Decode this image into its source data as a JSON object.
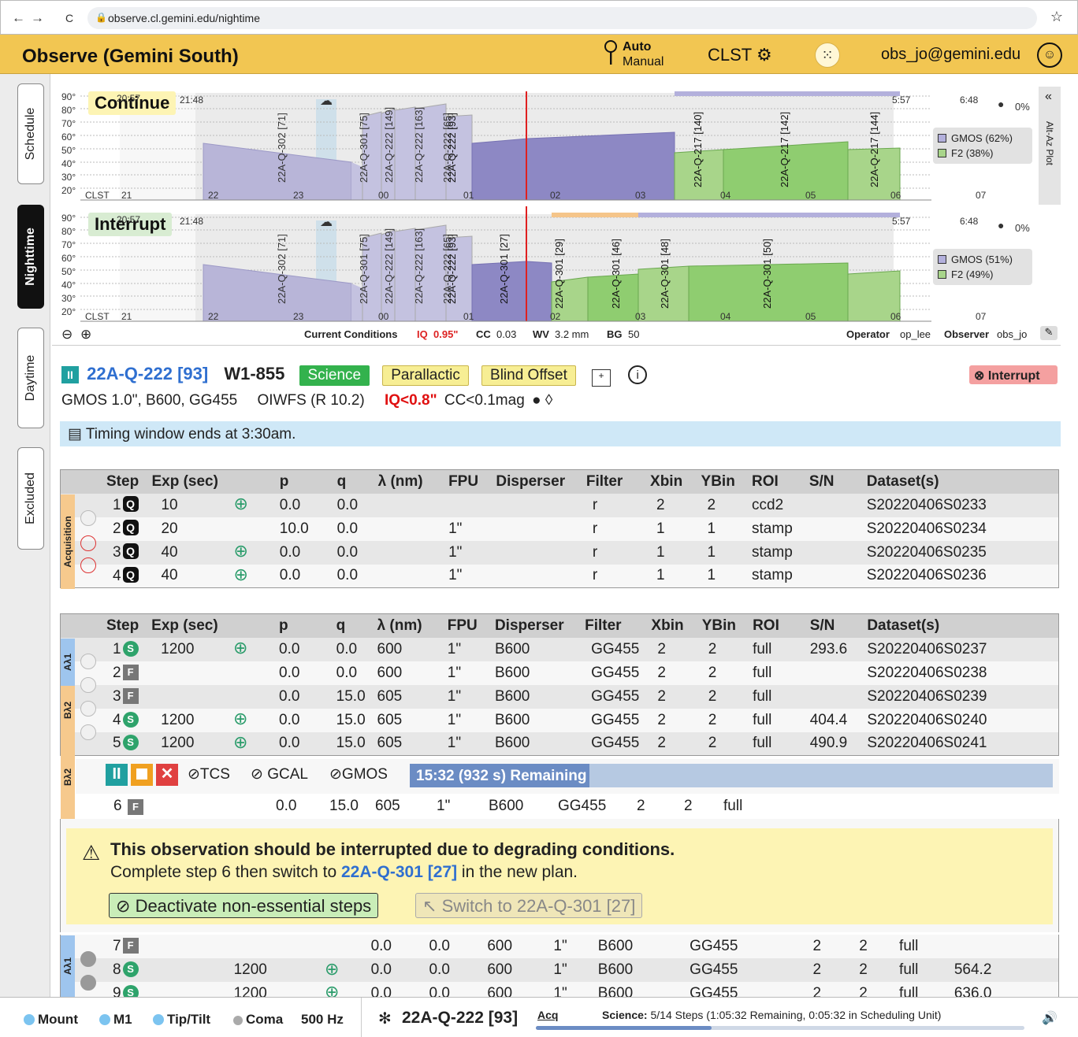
{
  "browser": {
    "back": "←",
    "forward": "→",
    "reload": "C",
    "url": "observe.cl.gemini.edu/nightime",
    "star": "☆"
  },
  "app": {
    "title": "Observe (Gemini South)",
    "mode_auto": "Auto",
    "mode_manual": "Manual",
    "clst": "CLST",
    "user": "obs_jo@gemini.edu"
  },
  "sidebar": {
    "tabs": [
      "Schedule",
      "Nighttime",
      "Daytime",
      "Excluded"
    ],
    "active": "Nighttime"
  },
  "plots": {
    "y_ticks": [
      "90°",
      "80°",
      "70°",
      "60°",
      "50°",
      "40°",
      "30°",
      "20°"
    ],
    "hours": [
      "CLST",
      "21",
      "22",
      "23",
      "00",
      "01",
      "02",
      "03",
      "04",
      "05",
      "06",
      "07"
    ],
    "twilight_labels": [
      "20:57",
      "21:48",
      "5:57",
      "6:48"
    ],
    "moon": "0%",
    "altaz": "Alt-Az Plot",
    "continue": {
      "label": "Continue",
      "legend": [
        {
          "name": "GMOS (62%)",
          "color": "#b3b0dc"
        },
        {
          "name": "F2 (38%)",
          "color": "#a8d58a"
        }
      ],
      "obs": [
        "22A-Q-302 [71]",
        "22A-Q-301 [75]",
        "22A-Q-222 [149]",
        "22A-Q-222 [163]",
        "22A-Q-222 [65]",
        "22A-Q-222 [93]",
        "22A-Q-217 [140]",
        "22A-Q-217 [142]",
        "22A-Q-217 [144]"
      ]
    },
    "interrupt": {
      "label": "Interrupt",
      "legend": [
        {
          "name": "GMOS (51%)",
          "color": "#b3b0dc"
        },
        {
          "name": "F2 (49%)",
          "color": "#a8d58a"
        }
      ],
      "obs": [
        "22A-Q-302 [71]",
        "22A-Q-301 [75]",
        "22A-Q-222 [149]",
        "22A-Q-222 [163]",
        "22A-Q-222 [65]",
        "22A-Q-222 [93]",
        "22A-Q-301 [27]",
        "22A-Q-301 [29]",
        "22A-Q-301 [46]",
        "22A-Q-301 [48]",
        "22A-Q-301 [50]"
      ]
    }
  },
  "conditions": {
    "label": "Current Conditions",
    "iq_label": "IQ",
    "iq": "0.95\"",
    "cc_label": "CC",
    "cc": "0.03",
    "wv_label": "WV",
    "wv": "3.2 mm",
    "bg_label": "BG",
    "bg": "50",
    "operator_label": "Operator",
    "operator": "op_lee",
    "observer_label": "Observer",
    "observer": "obs_jo"
  },
  "observation": {
    "id": "22A-Q-222 [93]",
    "target": "W1-855",
    "badges": [
      "Science",
      "Parallactic",
      "Blind Offset"
    ],
    "instrument": "GMOS 1.0\", B600, GG455",
    "oiwfs": "OIWFS (R 10.2)",
    "iq_req": "IQ<0.8\"",
    "cc_req": "CC<0.1mag",
    "interrupt": "Interrupt",
    "timing": "Timing window ends at 3:30am."
  },
  "columns": [
    "Step",
    "Exp (sec)",
    "",
    "p",
    "q",
    "λ (nm)",
    "FPU",
    "Disperser",
    "Filter",
    "Xbin",
    "YBin",
    "ROI",
    "S/N",
    "Dataset(s)"
  ],
  "acq_label": "Acquisition",
  "acquisition": [
    {
      "step": "1",
      "type": "Q",
      "exp": "10",
      "target": true,
      "p": "0.0",
      "q": "0.0",
      "lambda": "",
      "fpu": "",
      "disp": "",
      "filter": "r",
      "xbin": "2",
      "ybin": "2",
      "roi": "ccd2",
      "sn": "",
      "ds": "S20220406S0233"
    },
    {
      "step": "2",
      "type": "Q",
      "exp": "20",
      "target": false,
      "p": "10.0",
      "q": "0.0",
      "lambda": "",
      "fpu": "1\"",
      "disp": "",
      "filter": "r",
      "xbin": "1",
      "ybin": "1",
      "roi": "stamp",
      "sn": "",
      "ds": "S20220406S0234"
    },
    {
      "step": "3",
      "type": "Q",
      "exp": "40",
      "target": true,
      "p": "0.0",
      "q": "0.0",
      "lambda": "",
      "fpu": "1\"",
      "disp": "",
      "filter": "r",
      "xbin": "1",
      "ybin": "1",
      "roi": "stamp",
      "sn": "",
      "ds": "S20220406S0235"
    },
    {
      "step": "4",
      "type": "Q",
      "exp": "40",
      "target": true,
      "p": "0.0",
      "q": "0.0",
      "lambda": "",
      "fpu": "1\"",
      "disp": "",
      "filter": "r",
      "xbin": "1",
      "ybin": "1",
      "roi": "stamp",
      "sn": "",
      "ds": "S20220406S0236"
    }
  ],
  "groups": [
    "Aλ1",
    "Bλ2",
    "Bλ2",
    "Aλ1"
  ],
  "science": [
    {
      "step": "1",
      "type": "S",
      "exp": "1200",
      "target": true,
      "p": "0.0",
      "q": "0.0",
      "lambda": "600",
      "fpu": "1\"",
      "disp": "B600",
      "filter": "GG455",
      "xbin": "2",
      "ybin": "2",
      "roi": "full",
      "sn": "293.6",
      "ds": "S20220406S0237"
    },
    {
      "step": "2",
      "type": "F",
      "exp": "",
      "target": false,
      "p": "0.0",
      "q": "0.0",
      "lambda": "600",
      "fpu": "1\"",
      "disp": "B600",
      "filter": "GG455",
      "xbin": "2",
      "ybin": "2",
      "roi": "full",
      "sn": "",
      "ds": "S20220406S0238"
    },
    {
      "step": "3",
      "type": "F",
      "exp": "",
      "target": false,
      "p": "0.0",
      "q": "15.0",
      "lambda": "605",
      "fpu": "1\"",
      "disp": "B600",
      "filter": "GG455",
      "xbin": "2",
      "ybin": "2",
      "roi": "full",
      "sn": "",
      "ds": "S20220406S0239"
    },
    {
      "step": "4",
      "type": "S",
      "exp": "1200",
      "target": true,
      "p": "0.0",
      "q": "15.0",
      "lambda": "605",
      "fpu": "1\"",
      "disp": "B600",
      "filter": "GG455",
      "xbin": "2",
      "ybin": "2",
      "roi": "full",
      "sn": "404.4",
      "ds": "S20220406S0240"
    },
    {
      "step": "5",
      "type": "S",
      "exp": "1200",
      "target": true,
      "p": "0.0",
      "q": "15.0",
      "lambda": "605",
      "fpu": "1\"",
      "disp": "B600",
      "filter": "GG455",
      "xbin": "2",
      "ybin": "2",
      "roi": "full",
      "sn": "490.9",
      "ds": "S20220406S0241"
    }
  ],
  "running": {
    "tcs": "TCS",
    "gcal": "GCAL",
    "gmos": "GMOS",
    "progress_text": "15:32 (932 s) Remaining",
    "progress": 0.28
  },
  "step6": {
    "step": "6",
    "type": "F",
    "exp": "",
    "p": "0.0",
    "q": "15.0",
    "lambda": "605",
    "fpu": "1\"",
    "disp": "B600",
    "filter": "GG455",
    "xbin": "2",
    "ybin": "2",
    "roi": "full"
  },
  "warning": {
    "title": "This observation should be interrupted due to degrading conditions.",
    "msg_pre": "Complete step 6 then switch to",
    "link": "22A-Q-301 [27]",
    "msg_post": "in the new plan.",
    "btn1": "Deactivate non-essential steps",
    "btn2": "Switch to 22A-Q-301 [27]"
  },
  "tail": [
    {
      "step": "7",
      "type": "F",
      "exp": "",
      "target": false,
      "p": "0.0",
      "q": "0.0",
      "lambda": "600",
      "fpu": "1\"",
      "disp": "B600",
      "filter": "GG455",
      "xbin": "2",
      "ybin": "2",
      "roi": "full",
      "sn": ""
    },
    {
      "step": "8",
      "type": "S",
      "exp": "1200",
      "target": true,
      "p": "0.0",
      "q": "0.0",
      "lambda": "600",
      "fpu": "1\"",
      "disp": "B600",
      "filter": "GG455",
      "xbin": "2",
      "ybin": "2",
      "roi": "full",
      "sn": "564.2"
    },
    {
      "step": "9",
      "type": "S",
      "exp": "1200",
      "target": true,
      "p": "0.0",
      "q": "0.0",
      "lambda": "600",
      "fpu": "1\"",
      "disp": "B600",
      "filter": "GG455",
      "xbin": "2",
      "ybin": "2",
      "roi": "full",
      "sn": "636.0"
    }
  ],
  "status": {
    "mount": "Mount",
    "m1": "M1",
    "tiptilt": "Tip/Tilt",
    "coma": "Coma",
    "hz": "500 Hz",
    "obs": "22A-Q-222 [93]",
    "acq": "Acq",
    "science_label": "Science:",
    "science": "5/14 Steps (1:05:32 Remaining, 0:05:32 in Scheduling Unit)",
    "progress": 0.36
  }
}
